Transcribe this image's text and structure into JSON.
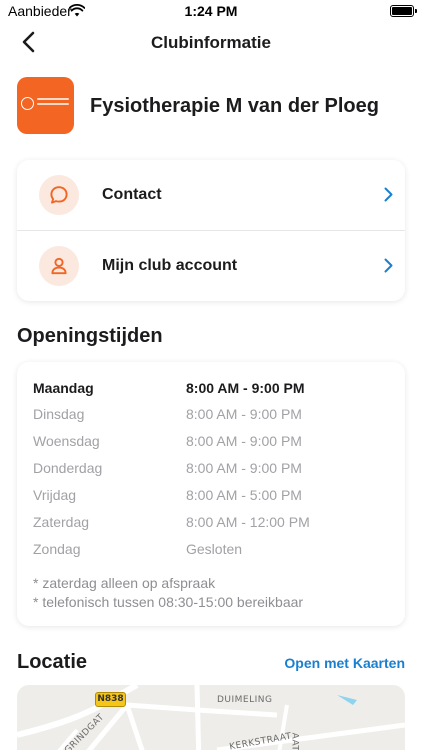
{
  "status_bar": {
    "carrier": "Aanbieder",
    "time": "1:24 PM"
  },
  "nav": {
    "title": "Clubinformatie"
  },
  "club": {
    "name": "Fysiotherapie M van der Ploeg",
    "brand_color": "#f26522"
  },
  "menu": [
    {
      "label": "Contact",
      "icon": "chat-bubble-icon"
    },
    {
      "label": "Mijn club account",
      "icon": "person-icon"
    }
  ],
  "opening_hours": {
    "title": "Openingstijden",
    "rows": [
      {
        "day": "Maandag",
        "hours": "8:00 AM - 9:00 PM",
        "today": true
      },
      {
        "day": "Dinsdag",
        "hours": "8:00 AM - 9:00 PM",
        "today": false
      },
      {
        "day": "Woensdag",
        "hours": "8:00 AM - 9:00 PM",
        "today": false
      },
      {
        "day": "Donderdag",
        "hours": "8:00 AM - 9:00 PM",
        "today": false
      },
      {
        "day": "Vrijdag",
        "hours": "8:00 AM - 5:00 PM",
        "today": false
      },
      {
        "day": "Zaterdag",
        "hours": "8:00 AM - 12:00 PM",
        "today": false
      },
      {
        "day": "Zondag",
        "hours": "Gesloten",
        "today": false
      }
    ],
    "notes": [
      "* zaterdag alleen op afspraak",
      "* telefonisch tussen 08:30-15:00 bereikbaar"
    ]
  },
  "location": {
    "title": "Locatie",
    "maps_link": "Open met Kaarten",
    "map_labels": {
      "route": "N838",
      "street_1": "GRINDGAT",
      "street_2": "DUIMELING",
      "street_3": "KERKSTRAAT",
      "street_4": "AAT"
    }
  },
  "colors": {
    "accent": "#f26522",
    "link": "#1a7fcf",
    "chevron": "#1a7fcf",
    "icon_bg": "#fbe8df"
  }
}
